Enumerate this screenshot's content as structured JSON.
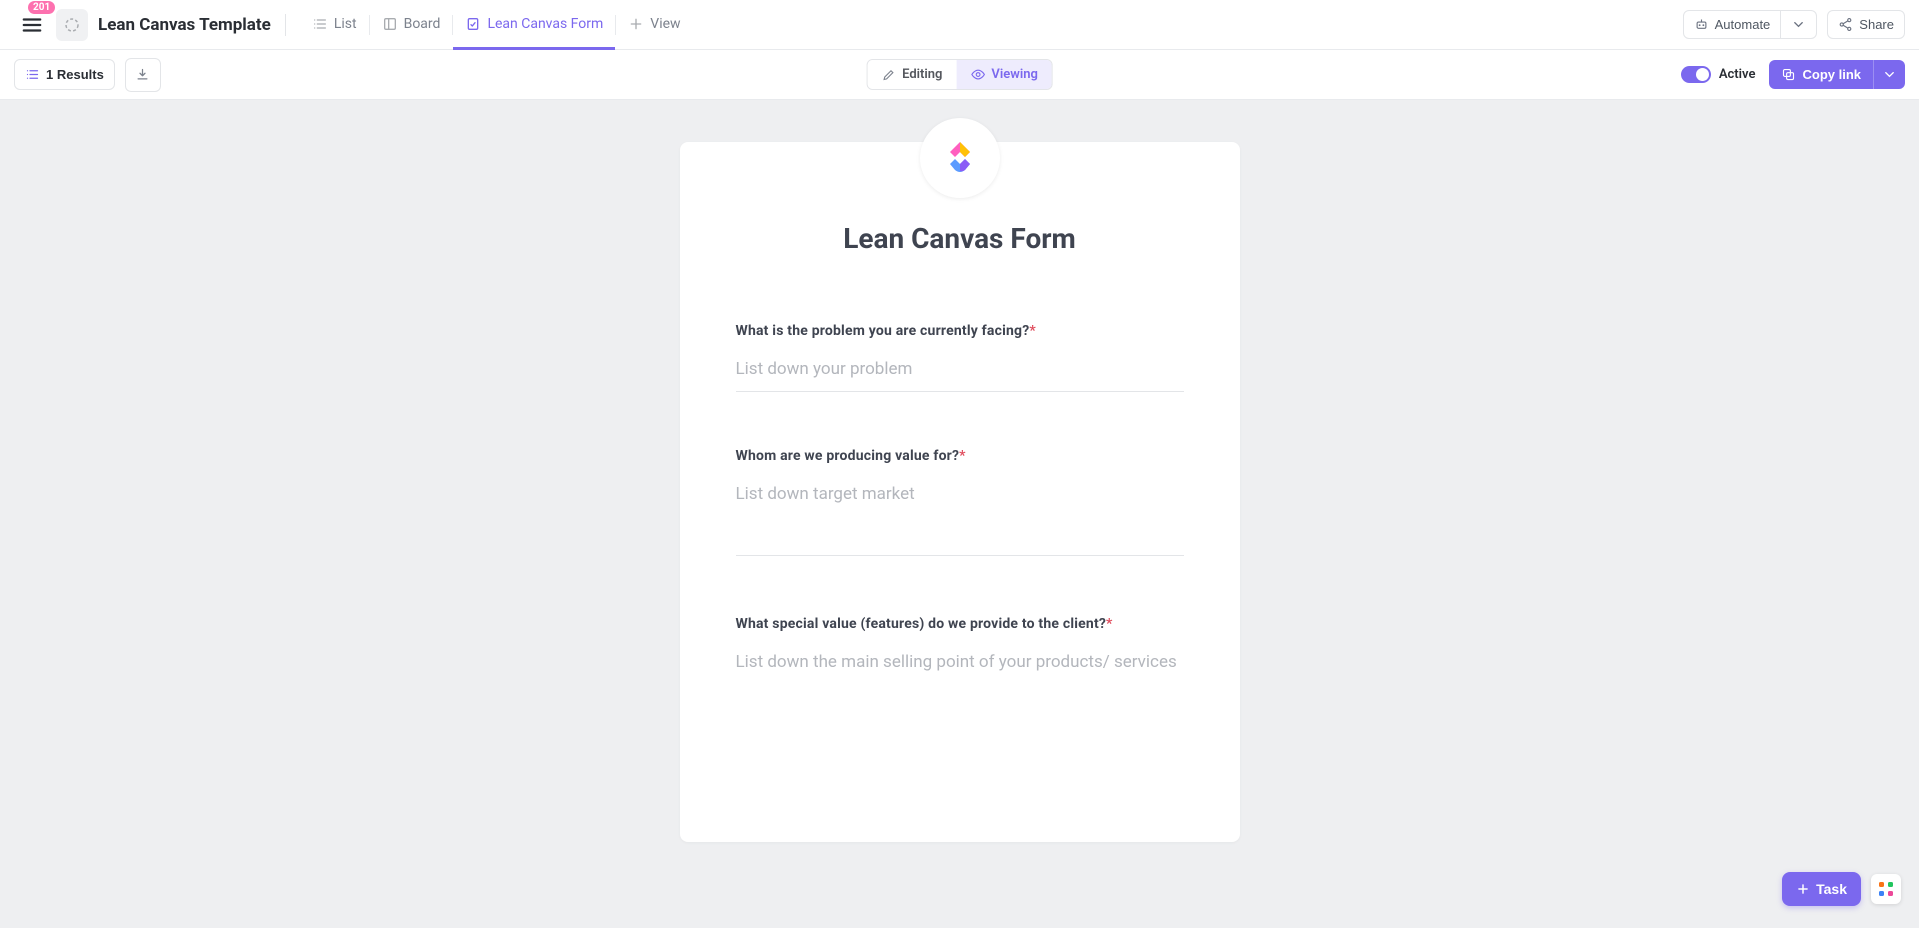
{
  "header": {
    "menu_badge": "201",
    "title": "Lean Canvas Template",
    "tabs": [
      {
        "label": "List"
      },
      {
        "label": "Board"
      },
      {
        "label": "Lean Canvas Form"
      },
      {
        "label": "View"
      }
    ],
    "automate_label": "Automate",
    "share_label": "Share"
  },
  "subbar": {
    "results": "1 Results",
    "mode_edit": "Editing",
    "mode_view": "Viewing",
    "active_label": "Active",
    "copy_link": "Copy link"
  },
  "form": {
    "title": "Lean Canvas Form",
    "fields": [
      {
        "label": "What is the problem you are currently facing?",
        "placeholder": "List down your problem",
        "required": true,
        "type": "input"
      },
      {
        "label": "Whom are we producing value for?",
        "placeholder": "List down target market",
        "required": true,
        "type": "textarea"
      },
      {
        "label": "What special value (features) do we provide to the client?",
        "placeholder": "List down the main selling point of your products/ services",
        "required": true,
        "type": "textarea_open"
      }
    ]
  },
  "float": {
    "task_label": "Task"
  }
}
